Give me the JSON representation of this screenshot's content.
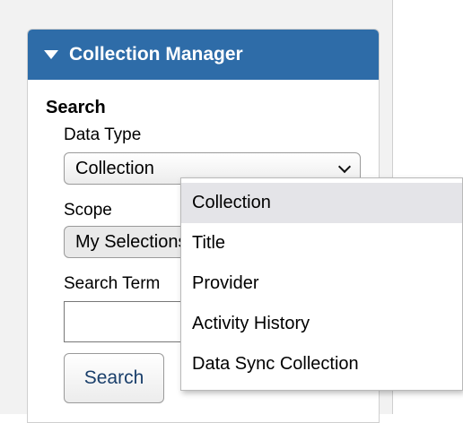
{
  "panel": {
    "title": "Collection Manager"
  },
  "search": {
    "section_title": "Search",
    "data_type_label": "Data Type",
    "data_type_value": "Collection",
    "scope_label": "Scope",
    "scope_value": "My Selections",
    "search_term_label": "Search Term",
    "search_term_value": "",
    "search_button_label": "Search"
  },
  "dropdown": {
    "selected_index": 0,
    "options": [
      {
        "label": "Collection"
      },
      {
        "label": "Title"
      },
      {
        "label": "Provider"
      },
      {
        "label": "Activity History"
      },
      {
        "label": "Data Sync Collection"
      }
    ]
  }
}
